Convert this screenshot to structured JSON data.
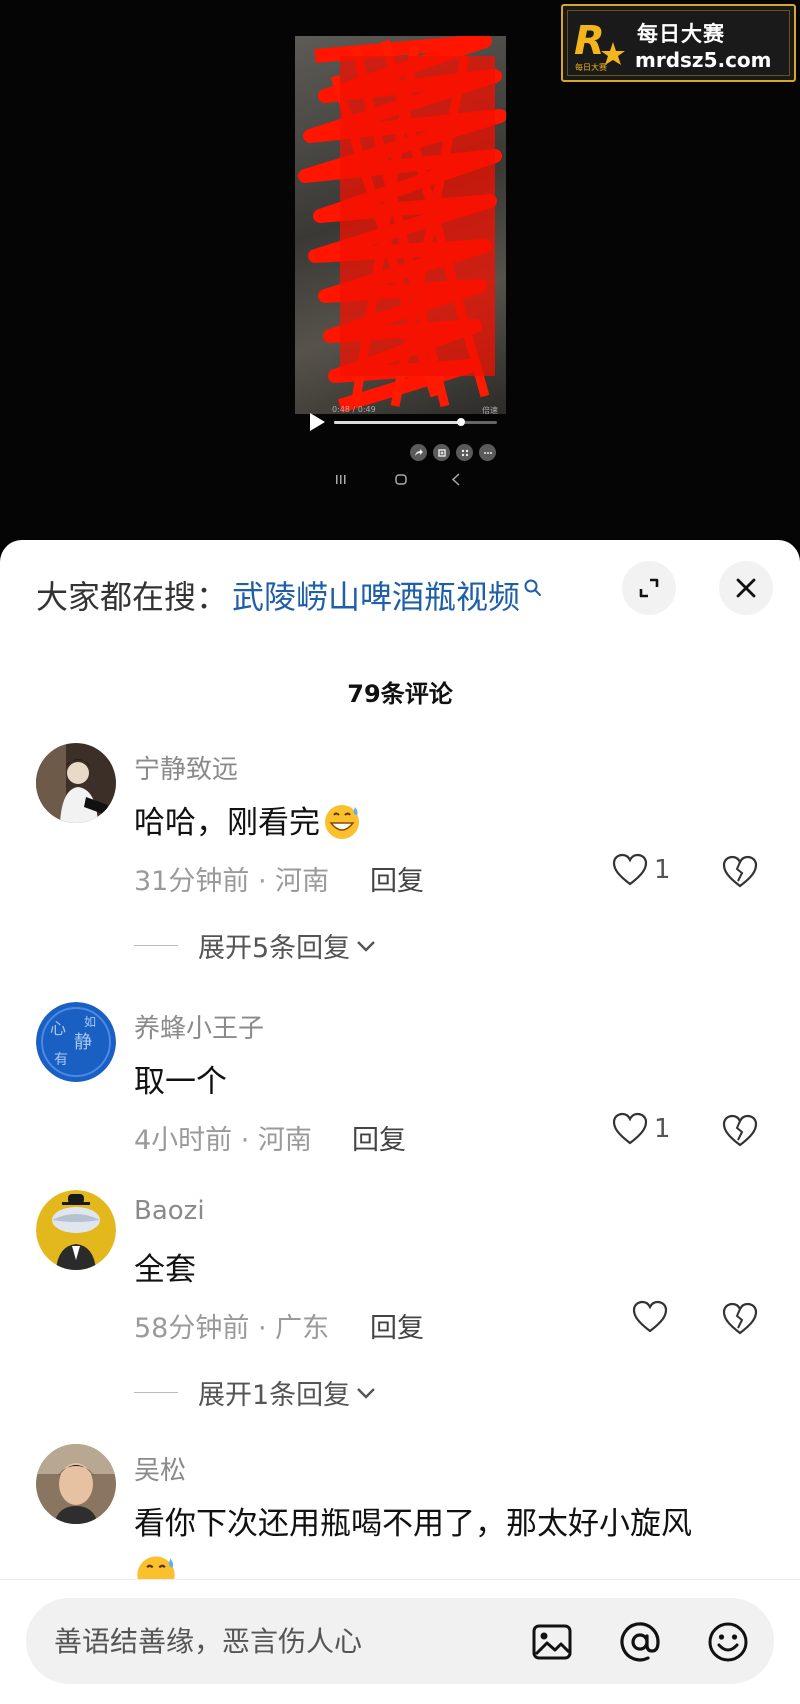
{
  "watermark": {
    "logo_letter": "R",
    "logo_caption": "每日大赛",
    "title": "每日大赛",
    "domain": "mrdsz5.com"
  },
  "video": {
    "progress": 0.78,
    "time_text": "0:48 / 0:49",
    "quality_text": "倍速"
  },
  "sheet": {
    "suggest_prefix": "大家都在搜：",
    "suggest_query": "武陵崂山啤酒瓶视频",
    "comment_count": "79条评论"
  },
  "comments": [
    {
      "user": "宁静致远",
      "text": "哈哈，刚看完",
      "meta": "31分钟前 · 河南",
      "reply": "回复",
      "likes": "1",
      "expand": "展开5条回复"
    },
    {
      "user": "养蜂小王子",
      "text": "取一个",
      "meta": "4小时前 · 河南",
      "reply": "回复",
      "likes": "1"
    },
    {
      "user": "Baozi",
      "text": "全套",
      "meta": "58分钟前 · 广东",
      "reply": "回复",
      "likes": "",
      "expand": "展开1条回复"
    },
    {
      "user": "吴松",
      "text": "看你下次还用瓶喝不用了，那太好小旋风"
    }
  ],
  "input": {
    "placeholder": "善语结善缘，恶言伤人心"
  },
  "colors": {
    "link_blue": "#1f5fa8",
    "watermark_gold": "#d9a52a"
  },
  "icons": [
    "expand-icon",
    "close-icon",
    "search-icon",
    "heart-icon",
    "broken-heart-icon",
    "image-icon",
    "at-icon",
    "emoji-icon",
    "play-icon"
  ]
}
